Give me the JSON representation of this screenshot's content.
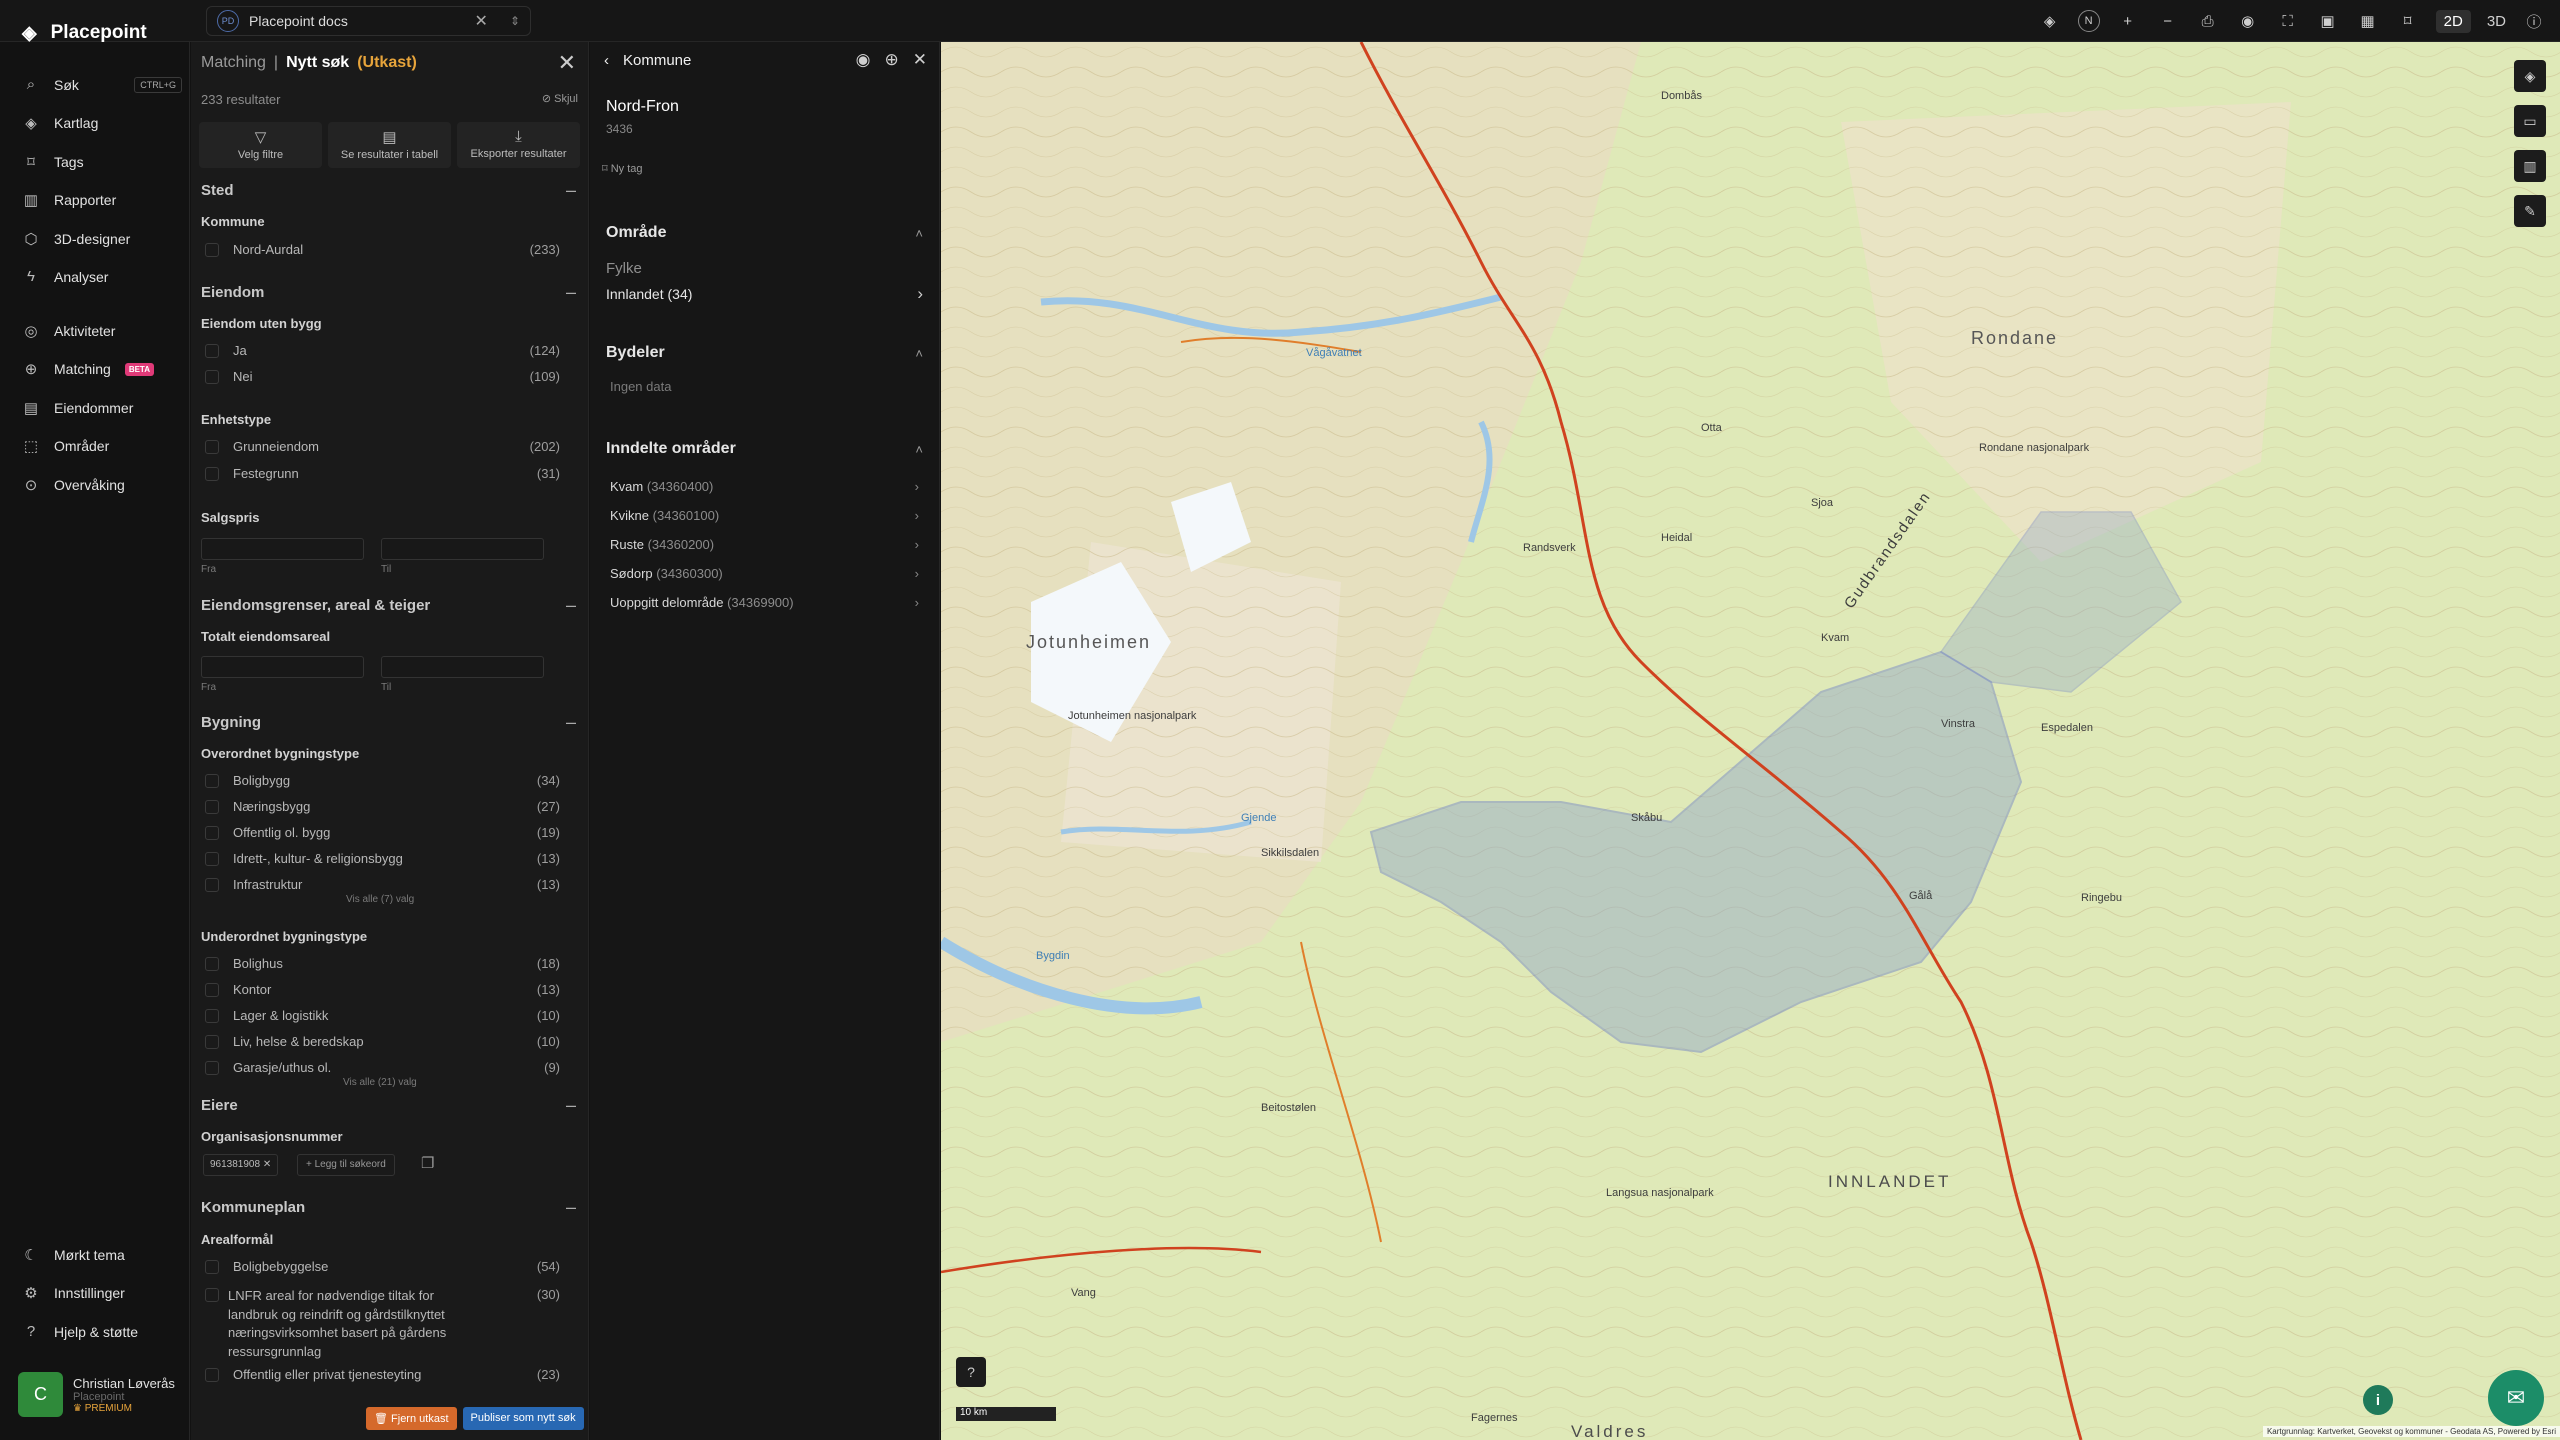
{
  "app": {
    "name": "Placepoint"
  },
  "docs_tab": {
    "badge": "PD",
    "label": "Placepoint docs"
  },
  "top_icons": [
    "layers-icon",
    "compass-icon",
    "plus-icon",
    "minus-icon",
    "print-icon",
    "eye-icon",
    "fullscreen-icon",
    "camera-icon",
    "grid-icon",
    "bookmark-icon"
  ],
  "view_modes": {
    "mode_2d": "2D",
    "mode_3d": "3D"
  },
  "compass_label": "N",
  "nav": [
    {
      "id": "sok",
      "label": "Søk",
      "shortcut": "CTRL+G",
      "icon": "search-icon"
    },
    {
      "id": "kartlag",
      "label": "Kartlag",
      "icon": "layers-icon"
    },
    {
      "id": "tags",
      "label": "Tags",
      "icon": "bookmark-icon"
    },
    {
      "id": "rapporter",
      "label": "Rapporter",
      "icon": "chart-icon"
    },
    {
      "id": "3d",
      "label": "3D-designer",
      "icon": "cube-icon"
    },
    {
      "id": "analyser",
      "label": "Analyser",
      "icon": "bolt-icon"
    },
    {
      "id": "aktiviteter",
      "label": "Aktiviteter",
      "icon": "activity-icon"
    },
    {
      "id": "matching",
      "label": "Matching",
      "badge": "BETA",
      "icon": "match-icon"
    },
    {
      "id": "eiendommer",
      "label": "Eiendommer",
      "icon": "property-icon"
    },
    {
      "id": "omrader",
      "label": "Områder",
      "icon": "area-icon"
    },
    {
      "id": "overvaking",
      "label": "Overvåking",
      "icon": "monitor-icon"
    }
  ],
  "nav_bottom": [
    {
      "id": "tema",
      "label": "Mørkt tema",
      "icon": "moon-icon"
    },
    {
      "id": "innst",
      "label": "Innstillinger",
      "icon": "gear-icon"
    },
    {
      "id": "hjelp",
      "label": "Hjelp & støtte",
      "icon": "help-icon"
    }
  ],
  "user": {
    "initial": "C",
    "name": "Christian Løverås",
    "org": "Placepoint",
    "plan": "PREMIUM"
  },
  "filter": {
    "crumb": "Matching",
    "sep": "|",
    "title": "Nytt søk",
    "draft": "(Utkast)",
    "results": "233 resultater",
    "hide": "Skjul",
    "actions": [
      "Velg filtre",
      "Se resultater i tabell",
      "Eksporter resultater"
    ],
    "sted": {
      "title": "Sted",
      "kommune_label": "Kommune",
      "items": [
        {
          "label": "Nord-Aurdal",
          "count": "(233)"
        }
      ]
    },
    "eiendom": {
      "title": "Eiendom",
      "uten_bygg_label": "Eiendom uten bygg",
      "uten_bygg": [
        {
          "label": "Ja",
          "count": "(124)"
        },
        {
          "label": "Nei",
          "count": "(109)"
        }
      ],
      "enhet_label": "Enhetstype",
      "enhet": [
        {
          "label": "Grunneiendom",
          "count": "(202)"
        },
        {
          "label": "Festegrunn",
          "count": "(31)"
        }
      ],
      "salgspris_label": "Salgspris",
      "from": "Fra",
      "to": "Til"
    },
    "grenser": {
      "title": "Eiendomsgrenser, areal & teiger",
      "areal_label": "Totalt eiendomsareal",
      "from": "Fra",
      "to": "Til"
    },
    "bygning": {
      "title": "Bygning",
      "over_label": "Overordnet bygningstype",
      "over": [
        {
          "label": "Boligbygg",
          "count": "(34)"
        },
        {
          "label": "Næringsbygg",
          "count": "(27)"
        },
        {
          "label": "Offentlig ol. bygg",
          "count": "(19)"
        },
        {
          "label": "Idrett-, kultur- & religionsbygg",
          "count": "(13)"
        },
        {
          "label": "Infrastruktur",
          "count": "(13)"
        }
      ],
      "over_more": "Vis alle (7) valg",
      "under_label": "Underordnet bygningstype",
      "under": [
        {
          "label": "Bolighus",
          "count": "(18)"
        },
        {
          "label": "Kontor",
          "count": "(13)"
        },
        {
          "label": "Lager & logistikk",
          "count": "(10)"
        },
        {
          "label": "Liv, helse & beredskap",
          "count": "(10)"
        },
        {
          "label": "Garasje/uthus ol.",
          "count": "(9)"
        }
      ],
      "under_more": "Vis alle (21) valg"
    },
    "eiere": {
      "title": "Eiere",
      "org_label": "Organisasjonsnummer",
      "chip": "961381908",
      "add": "+ Legg til søkeord"
    },
    "kommuneplan": {
      "title": "Kommuneplan",
      "areal_label": "Arealformål",
      "items": [
        {
          "label": "Boligbebyggelse",
          "count": "(54)"
        },
        {
          "label": "LNFR areal for nødvendige tiltak for landbruk og reindrift og gårdstilknyttet næringsvirksomhet basert på gårdens ressursgrunnlag",
          "count": "(30)"
        },
        {
          "label": "Offentlig eller privat tjenesteyting",
          "count": "(23)"
        }
      ]
    },
    "btn_remove": "Fjern utkast",
    "btn_publish": "Publiser som nytt søk"
  },
  "detail": {
    "title": "Kommune",
    "name": "Nord-Fron",
    "code": "3436",
    "tag": "Ny tag",
    "omrade_title": "Område",
    "fylke_label": "Fylke",
    "fylke_value": "Innlandet (34)",
    "bydeler_title": "Bydeler",
    "bydeler_empty": "Ingen data",
    "inndelte_title": "Inndelte områder",
    "inndelte": [
      {
        "name": "Kvam",
        "code": "(34360400)"
      },
      {
        "name": "Kvikne",
        "code": "(34360100)"
      },
      {
        "name": "Ruste",
        "code": "(34360200)"
      },
      {
        "name": "Sødorp",
        "code": "(34360300)"
      },
      {
        "name": "Uoppgitt delområde",
        "code": "(34369900)"
      }
    ]
  },
  "map": {
    "labels": [
      {
        "text": "Rondane"
      },
      {
        "text": "Jotunheimen"
      },
      {
        "text": "INNLANDET"
      },
      {
        "text": "Gudbrandsdalen"
      },
      {
        "text": "Rondane nasjonalpark"
      },
      {
        "text": "Jotunheimen nasjonalpark"
      },
      {
        "text": "Kvam"
      },
      {
        "text": "Vinstra"
      },
      {
        "text": "Vågåvatnet"
      },
      {
        "text": "Bygdin"
      },
      {
        "text": "Valdres"
      },
      {
        "text": "Skåbu"
      },
      {
        "text": "Otta"
      },
      {
        "text": "Dombås"
      },
      {
        "text": "Randsverk"
      },
      {
        "text": "Beitostølen"
      },
      {
        "text": "Gålå"
      },
      {
        "text": "Ringebu"
      },
      {
        "text": "Langsua nasjonalpark"
      },
      {
        "text": "Heidal"
      },
      {
        "text": "Sjoa"
      },
      {
        "text": "Vang"
      },
      {
        "text": "Fagernes"
      },
      {
        "text": "Espedalen"
      },
      {
        "text": "Gjende"
      },
      {
        "text": "Sikkilsdalen"
      }
    ],
    "scale": "10 km",
    "attribution": "Kartgrunnlag: Kartverket, Geovekst og kommuner - Geodata AS, Powered by Esri"
  },
  "colors": {
    "accent": "#e7a43b",
    "beta": "#e03a78",
    "publish": "#2868b3",
    "remove": "#d5692b",
    "municipality_fill": "#8ea6c9"
  }
}
